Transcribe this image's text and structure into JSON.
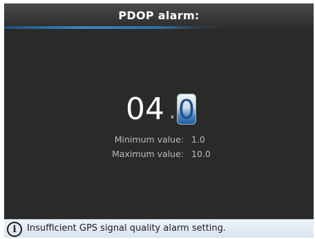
{
  "header": {
    "title": "PDOP alarm:"
  },
  "editor": {
    "integer_part": "04",
    "decimal_separator": ".",
    "active_digit": "0",
    "min_label": "Minimum value:",
    "min_value": "1.0",
    "max_label": "Maximum value:",
    "max_value": "10.0"
  },
  "info": {
    "icon": "info-icon",
    "text": "Insufficient GPS signal quality alarm setting."
  },
  "colors": {
    "background": "#2a2a28",
    "accent": "#3c86c4",
    "info_bar": "#dfe8f2"
  }
}
